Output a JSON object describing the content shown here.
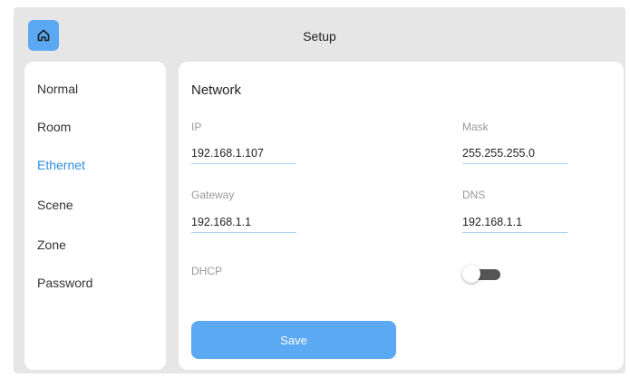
{
  "header": {
    "title": "Setup",
    "home_icon": "home-icon"
  },
  "sidebar": {
    "items": [
      {
        "label": "Normal"
      },
      {
        "label": "Room"
      },
      {
        "label": "Ethernet"
      },
      {
        "label": "Scene"
      },
      {
        "label": "Zone"
      },
      {
        "label": "Password"
      }
    ],
    "active": "Ethernet"
  },
  "network": {
    "title": "Network",
    "ip": {
      "label": "IP",
      "value": "192.168.1.107"
    },
    "mask": {
      "label": "Mask",
      "value": "255.255.255.0"
    },
    "gateway": {
      "label": "Gateway",
      "value": "192.168.1.1"
    },
    "dns": {
      "label": "DNS",
      "value": "192.168.1.1"
    },
    "dhcp": {
      "label": "DHCP",
      "enabled": false
    },
    "save_label": "Save"
  },
  "colors": {
    "accent": "#5aa9f2",
    "active_text": "#2f8ee0",
    "panel_bg": "#e6e6e6"
  }
}
